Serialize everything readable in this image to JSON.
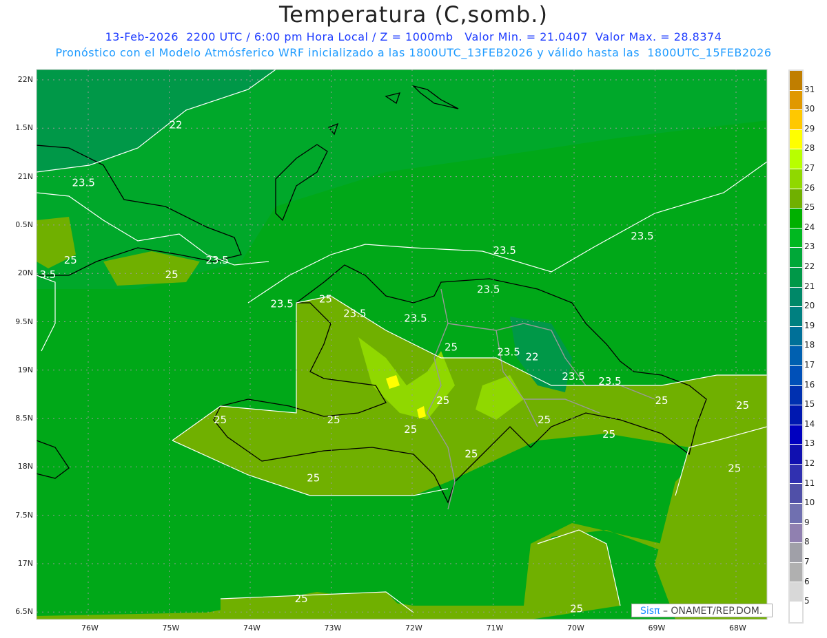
{
  "header": {
    "title": "Temperatura (C,somb.)",
    "line1": "13-Feb-2026  2200 UTC / 6:00 pm Hora Local / Z = 1000mb   Valor Min. = 21.0407  Valor Max. = 28.8374",
    "line2": "Pronóstico con el Modelo Atmósferico WRF inicializado a las 1800UTC_13FEB2026 y válido hasta las  1800UTC_15FEB2026"
  },
  "axes": {
    "lon_labels": [
      "76W",
      "75W",
      "74W",
      "73W",
      "72W",
      "71W",
      "70W",
      "69W",
      "68W"
    ],
    "lat_labels": [
      "22N",
      "1.5N",
      "21N",
      "0.5N",
      "20N",
      "9.5N",
      "19N",
      "8.5N",
      "18N",
      "7.5N",
      "17N",
      "6.5N"
    ]
  },
  "contour_labels": [
    {
      "t": "22",
      "lon": -75.0,
      "lat": 21.5
    },
    {
      "t": "23.5",
      "lon": -76.2,
      "lat": 20.9
    },
    {
      "t": "25",
      "lon": -76.3,
      "lat": 20.1
    },
    {
      "t": "3.5",
      "lon": -76.6,
      "lat": 19.95
    },
    {
      "t": "25",
      "lon": -75.05,
      "lat": 19.95
    },
    {
      "t": "23.5",
      "lon": -74.55,
      "lat": 20.1
    },
    {
      "t": "23.5",
      "lon": -71.0,
      "lat": 20.2
    },
    {
      "t": "23.5",
      "lon": -69.3,
      "lat": 20.35
    },
    {
      "t": "23.5",
      "lon": -73.75,
      "lat": 19.65
    },
    {
      "t": "25",
      "lon": -73.15,
      "lat": 19.7
    },
    {
      "t": "23.5",
      "lon": -72.85,
      "lat": 19.55
    },
    {
      "t": "23.5",
      "lon": -72.1,
      "lat": 19.5
    },
    {
      "t": "23.5",
      "lon": -71.2,
      "lat": 19.8
    },
    {
      "t": "25",
      "lon": -71.6,
      "lat": 19.2
    },
    {
      "t": "23.5",
      "lon": -70.95,
      "lat": 19.15
    },
    {
      "t": "22",
      "lon": -70.6,
      "lat": 19.1
    },
    {
      "t": "23.5",
      "lon": -70.15,
      "lat": 18.9
    },
    {
      "t": "23.5",
      "lon": -69.7,
      "lat": 18.85
    },
    {
      "t": "25",
      "lon": -71.7,
      "lat": 18.65
    },
    {
      "t": "25",
      "lon": -70.45,
      "lat": 18.45
    },
    {
      "t": "25",
      "lon": -69.0,
      "lat": 18.65
    },
    {
      "t": "25",
      "lon": -68.0,
      "lat": 18.6
    },
    {
      "t": "25",
      "lon": -69.65,
      "lat": 18.3
    },
    {
      "t": "25",
      "lon": -74.45,
      "lat": 18.45
    },
    {
      "t": "25",
      "lon": -73.05,
      "lat": 18.45
    },
    {
      "t": "25",
      "lon": -72.1,
      "lat": 18.35
    },
    {
      "t": "25",
      "lon": -71.35,
      "lat": 18.1
    },
    {
      "t": "25",
      "lon": -73.3,
      "lat": 17.85
    },
    {
      "t": "25",
      "lon": -68.1,
      "lat": 17.95
    },
    {
      "t": "25",
      "lon": -73.45,
      "lat": 16.6
    },
    {
      "t": "25",
      "lon": -70.05,
      "lat": 16.5
    }
  ],
  "colorbar": {
    "labels": [
      "31",
      "30",
      "29",
      "28",
      "27",
      "26",
      "25",
      "24",
      "23",
      "22",
      "21",
      "20",
      "19",
      "18",
      "17",
      "16",
      "15",
      "14",
      "13",
      "12",
      "11",
      "10",
      "9",
      "8",
      "7",
      "6",
      "5"
    ],
    "colors": [
      "#c07e00",
      "#e09800",
      "#ffc800",
      "#ffff00",
      "#b8ff00",
      "#90d800",
      "#70b000",
      "#00b000",
      "#00b820",
      "#00a838",
      "#009848",
      "#008868",
      "#008080",
      "#007098",
      "#0060b0",
      "#0050b8",
      "#0030b0",
      "#0018b0",
      "#0000c0",
      "#1010b0",
      "#3030b0",
      "#5050a8",
      "#7070b0",
      "#9080b0",
      "#a0a0a8",
      "#b0b0b0",
      "#d8d8d8",
      "#ffffff"
    ]
  },
  "credit": {
    "logo": "Sisπ",
    "text": "– ONAMET/REP.DOM."
  }
}
